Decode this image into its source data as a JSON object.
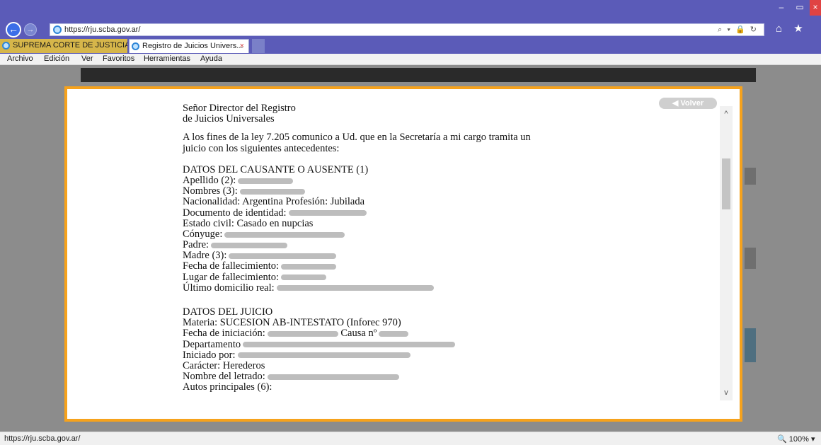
{
  "browser": {
    "url": "https://rju.scba.gov.ar/",
    "window_buttons": {
      "minimize": "–",
      "maximize": "▭",
      "close": "×"
    },
    "nav": {
      "back": "←",
      "forward": "→",
      "address_tools": "⌕ ▾ 🔒 ↻",
      "home_star": "⌂ ★"
    },
    "tabs": [
      {
        "label": "SUPREMA CORTE DE JUSTICIA ...",
        "active": false
      },
      {
        "label": "Registro de Juicios Univers...",
        "active": true,
        "close": "×"
      }
    ],
    "menu": [
      "Archivo",
      "Edición",
      "Ver",
      "Favoritos",
      "Herramientas",
      "Ayuda"
    ],
    "status_url": "https://rju.scba.gov.ar/",
    "zoom": "100%",
    "zoom_icon": "🔍"
  },
  "modal": {
    "volver_label": "◀ Volver",
    "scroll_up": "^",
    "scroll_down": "v"
  },
  "document": {
    "greeting_1": "Señor Director del Registro",
    "greeting_2": "de Juicios Universales",
    "intro_1": "A los fines de la ley 7.205 comunico a Ud. que en la Secretaría a mi cargo tramita un",
    "intro_2": "juicio con los siguientes antecedentes:",
    "causante_heading": "DATOS DEL CAUSANTE O AUSENTE (1)",
    "apellido": "Apellido (2):",
    "nombres": "Nombres (3):",
    "nacionalidad": "Nacionalidad: Argentina Profesión: Jubilada",
    "documento": "Documento de identidad:",
    "estado_civil": "Estado civil: Casado en nupcias",
    "conyuge": "Cónyuge:",
    "padre": "Padre:",
    "madre": "Madre (3):",
    "fecha_fallecimiento": "Fecha de fallecimiento:",
    "lugar_fallecimiento": "Lugar de fallecimiento:",
    "domicilio": "Último domicilio real:",
    "juicio_heading": "DATOS DEL JUICIO",
    "materia": "Materia: SUCESION AB-INTESTATO (Inforec 970)",
    "fecha_iniciacion": "Fecha de iniciación:",
    "causa_suffix": "Causa nº",
    "departamento": "Departamento",
    "iniciado_por": "Iniciado por:",
    "caracter": "Carácter: Herederos",
    "letrado": "Nombre del letrado:",
    "autos": "Autos principales (6):"
  }
}
